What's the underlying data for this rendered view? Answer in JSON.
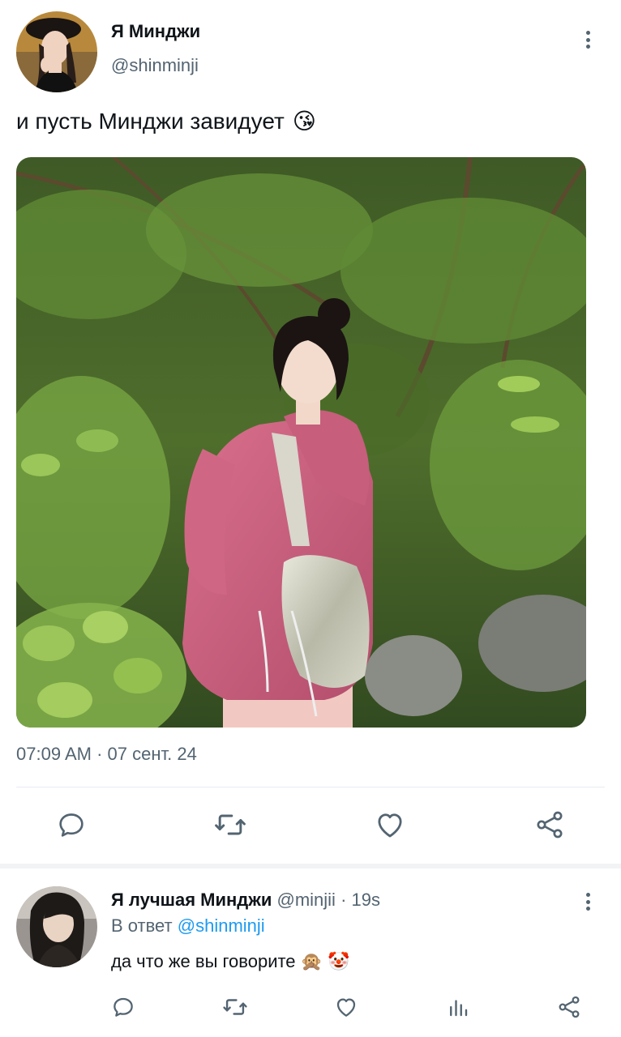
{
  "post": {
    "author_name": "Я Минджи",
    "author_handle": "@shinminji",
    "text": "и пусть Минджи завидует",
    "text_emoji": "😘",
    "timestamp": "07:09 AM · 07 сент. 24",
    "actions": [
      "reply",
      "retweet",
      "like",
      "share"
    ]
  },
  "reply": {
    "author_name": "Я лучшая Минджи",
    "author_handle": "@minjii",
    "separator": " · ",
    "time": "19s",
    "reply_to_prefix": "В ответ",
    "reply_to_handle": "@shinminji",
    "text": "да что же вы говорите",
    "emojis": [
      "🙊",
      "🤡"
    ],
    "actions": [
      "reply",
      "retweet",
      "like",
      "views",
      "share"
    ]
  },
  "colors": {
    "text_primary": "#0f1419",
    "text_secondary": "#536471",
    "mention": "#1d9bf0",
    "icon": "#536471"
  },
  "icons": {
    "more": "more-vertical-icon",
    "reply": "comment-bubble-icon",
    "retweet": "retweet-icon",
    "like": "heart-icon",
    "views": "bar-chart-icon",
    "share": "share-icon"
  }
}
